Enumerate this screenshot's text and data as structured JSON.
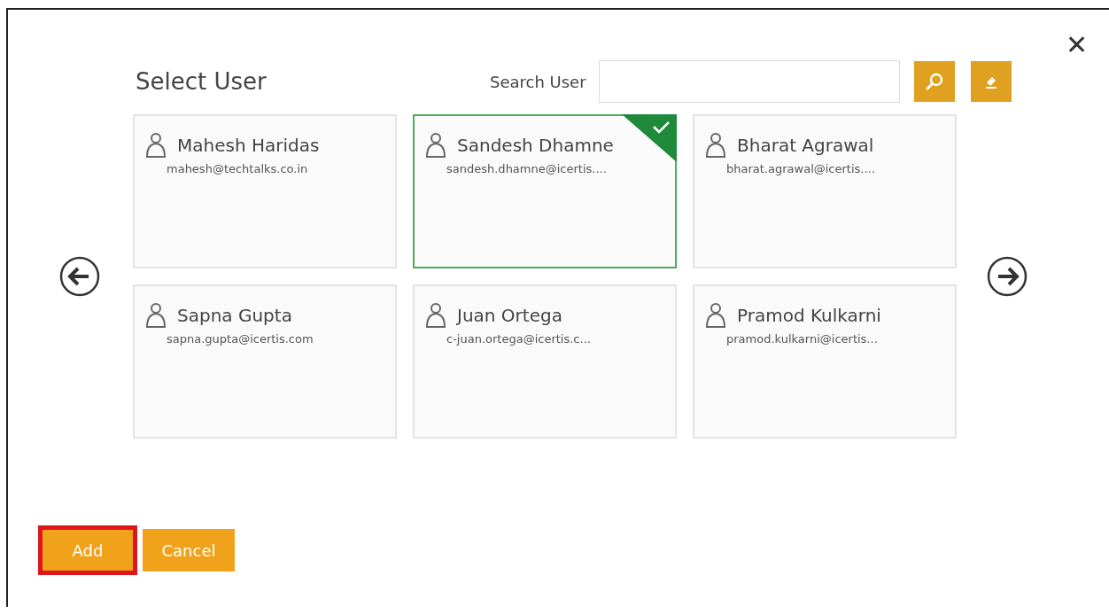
{
  "dialog": {
    "title": "Select User",
    "close": "✕"
  },
  "search": {
    "label": "Search User"
  },
  "users": [
    {
      "name": "Mahesh Haridas",
      "email": "mahesh@techtalks.co.in",
      "selected": false
    },
    {
      "name": "Sandesh Dhamne",
      "email": "sandesh.dhamne@icertis....",
      "selected": true
    },
    {
      "name": "Bharat Agrawal",
      "email": "bharat.agrawal@icertis....",
      "selected": false
    },
    {
      "name": "Sapna Gupta",
      "email": "sapna.gupta@icertis.com",
      "selected": false
    },
    {
      "name": "Juan Ortega",
      "email": "c-juan.ortega@icertis.c...",
      "selected": false
    },
    {
      "name": "Pramod Kulkarni",
      "email": "pramod.kulkarni@icertis...",
      "selected": false
    }
  ],
  "buttons": [
    {
      "label": "Add",
      "highlighted": true
    },
    {
      "label": "Cancel",
      "highlighted": false
    }
  ]
}
